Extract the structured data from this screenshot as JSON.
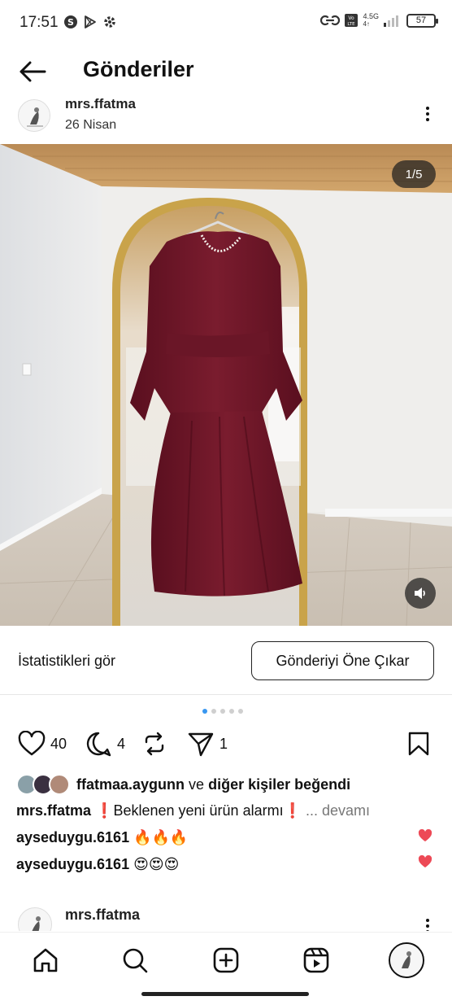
{
  "status_bar": {
    "time": "17:51",
    "network": "4.5G",
    "battery": "57",
    "icons": [
      "s-circle-icon",
      "play-store-icon",
      "gear-icon",
      "link-icon",
      "volte-icon",
      "signal-icon",
      "battery-icon"
    ]
  },
  "header": {
    "title": "Gönderiler",
    "back_icon": "arrow-left-icon"
  },
  "post": {
    "author": "mrs.ffatma",
    "date": "26 Nisan",
    "photo_counter": "1/5",
    "insights_label": "İstatistikleri gör",
    "boost_label": "Gönderiyi Öne Çıkar",
    "carousel_total": 5,
    "carousel_active": 1,
    "likes_count": "40",
    "comments_count": "4",
    "shares_count": "1",
    "liked_by_user": "ffatmaa.aygunn",
    "liked_by_connector": "ve",
    "liked_by_others": "diğer kişiler beğendi",
    "caption_user": "mrs.ffatma",
    "caption_text": "❗Beklenen yeni ürün alarmı❗",
    "caption_more": "... devamı",
    "comments": [
      {
        "user": "ayseduygu.6161",
        "text": "🔥🔥🔥"
      },
      {
        "user": "ayseduygu.6161",
        "text": "😍😍😍"
      }
    ]
  },
  "next_post": {
    "author": "mrs.ffatma"
  },
  "bottom_nav": {
    "items": [
      "home-icon",
      "search-icon",
      "create-icon",
      "reels-icon",
      "profile-avatar"
    ]
  },
  "colors": {
    "accent_blue": "#3897f0",
    "heart_red": "#ed4956",
    "dress": "#6b1526"
  }
}
